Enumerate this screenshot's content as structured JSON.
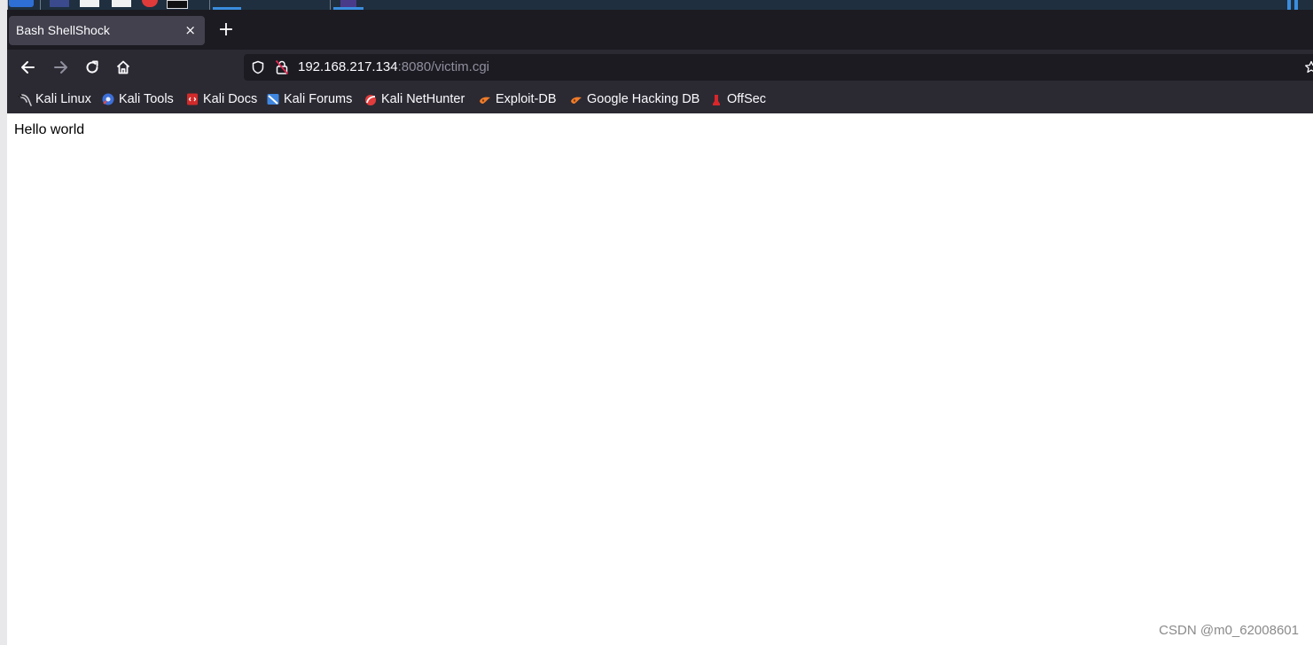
{
  "browser": {
    "tab": {
      "title": "Bash ShellShock",
      "close_glyph": "×"
    },
    "new_tab_glyph": "+",
    "nav": {
      "back_icon": "arrow-left-icon",
      "forward_icon": "arrow-right-icon",
      "reload_icon": "reload-icon",
      "home_icon": "home-icon"
    },
    "url": {
      "host": "192.168.217.134",
      "rest": ":8080/victim.cgi",
      "security_icons": [
        "shield-icon",
        "insecure-lock-icon"
      ]
    },
    "bookmarks": [
      {
        "label": "Kali Linux",
        "icon": "kali-dragon-icon"
      },
      {
        "label": "Kali Tools",
        "icon": "kali-tools-icon"
      },
      {
        "label": "Kali Docs",
        "icon": "kali-docs-icon"
      },
      {
        "label": "Kali Forums",
        "icon": "kali-forums-icon"
      },
      {
        "label": "Kali NetHunter",
        "icon": "nethunter-icon"
      },
      {
        "label": "Exploit-DB",
        "icon": "exploit-db-icon"
      },
      {
        "label": "Google Hacking DB",
        "icon": "ghdb-icon"
      },
      {
        "label": "OffSec",
        "icon": "offsec-icon"
      }
    ]
  },
  "page": {
    "body_text": "Hello world"
  },
  "watermark": "CSDN @m0_62008601",
  "colors": {
    "tabstrip": "#1c1b22",
    "toolbar": "#2b2a33",
    "tab_active": "#42414d",
    "text_light": "#fbfbfe",
    "url_muted": "#8f8f9d",
    "taskbar": "#1f2f3f",
    "accent": "#3a8dde"
  }
}
